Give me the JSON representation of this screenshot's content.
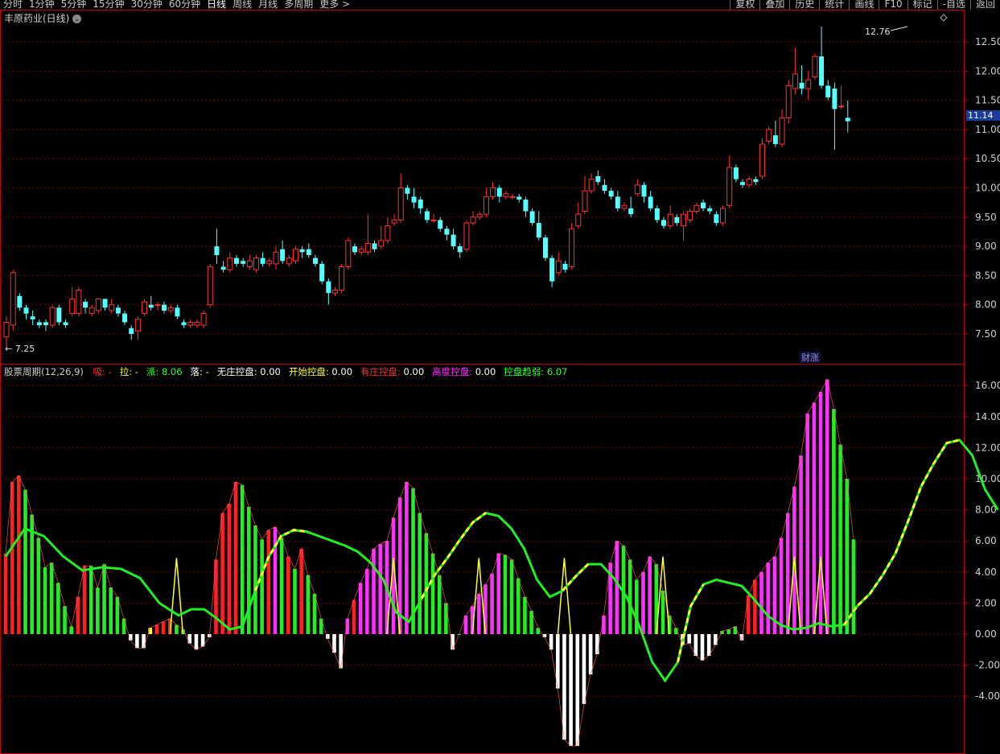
{
  "tabs": [
    "分时",
    "1分钟",
    "5分钟",
    "15分钟",
    "30分钟",
    "60分钟",
    "日线",
    "周线",
    "月线",
    "多周期",
    "更多 >"
  ],
  "active_tab": "日线",
  "right_buttons": [
    "复权",
    "叠加",
    "历史",
    "统计",
    "画线",
    "F10",
    "标记",
    "-自选",
    "返回"
  ],
  "stock_title": "丰原药业(日线)",
  "price_tag": "11.14",
  "high_label": "12.76",
  "low_label": "7.25",
  "event_label": "财涨",
  "price_axis": [
    "12.50",
    "12.00",
    "11.50",
    "11.00",
    "10.50",
    "10.00",
    "9.50",
    "9.00",
    "8.50",
    "8.00",
    "7.50"
  ],
  "ind_axis": [
    "16.00",
    "14.00",
    "12.00",
    "10.00",
    "8.00",
    "6.00",
    "4.00",
    "2.00",
    "0.00",
    "-2.00",
    "-4.00"
  ],
  "indicator": {
    "name": "股票周期(12,26,9)",
    "items": [
      {
        "label": "吸:",
        "value": "-",
        "color": "#ff3030"
      },
      {
        "label": "拉:",
        "value": "-",
        "color": "#ffff40"
      },
      {
        "label": "派:",
        "value": "8.06",
        "color": "#30ff30"
      },
      {
        "label": "落:",
        "value": "-",
        "color": "#ffffff"
      },
      {
        "label": "无庄控盘:",
        "value": "0.00",
        "color": "#ffffff"
      },
      {
        "label": "开始控盘:",
        "value": "0.00",
        "color": "#ffff40"
      },
      {
        "label": "有庄控盘:",
        "value": "0.00",
        "color": "#ff3030"
      },
      {
        "label": "高度控盘:",
        "value": "0.00",
        "color": "#ff30ff"
      },
      {
        "label": "控盘趋弱:",
        "value": "6.07",
        "color": "#30ff30"
      }
    ]
  },
  "colors": {
    "up": "#ff3232",
    "down": "#54ffff",
    "grid": "#7a0000",
    "frame": "#c00000"
  }
}
